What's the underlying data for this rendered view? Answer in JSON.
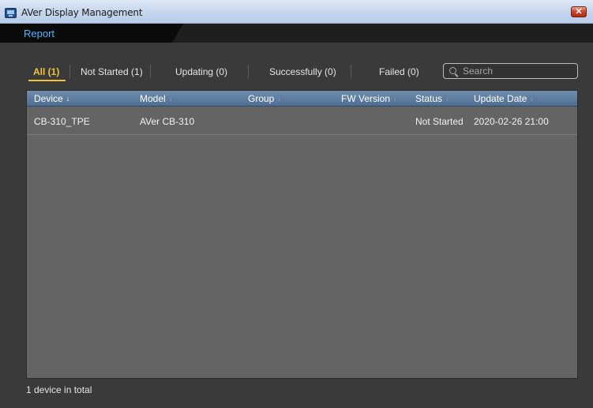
{
  "window": {
    "title": "AVer Display Management",
    "close_glyph": "✕"
  },
  "header": {
    "tab_label": "Report"
  },
  "filters": [
    {
      "label": "All (1)",
      "active": true
    },
    {
      "label": "Not Started (1)",
      "active": false
    },
    {
      "label": "Updating (0)",
      "active": false
    },
    {
      "label": "Successfully (0)",
      "active": false
    },
    {
      "label": "Failed (0)",
      "active": false
    }
  ],
  "search": {
    "placeholder": "Search",
    "value": ""
  },
  "table": {
    "columns": [
      {
        "label": "Device",
        "sort_active": true
      },
      {
        "label": "Model",
        "sort_active": false
      },
      {
        "label": "Group",
        "sort_active": false
      },
      {
        "label": "FW Version",
        "sort_active": false
      },
      {
        "label": "Status",
        "sort_active": false
      },
      {
        "label": "Update Date",
        "sort_active": false
      }
    ],
    "sort_glyph": "↓",
    "rows": [
      {
        "device": "CB-310_TPE",
        "model": "AVer CB-310",
        "group": "",
        "fw_version": "",
        "status": "Not Started",
        "update_date": "2020-02-26 21:00"
      }
    ]
  },
  "footer": {
    "count_text": "1 device in total"
  },
  "colors": {
    "accent_active_tab": "#f3c23a",
    "header_link": "#4fb6ff",
    "table_header": "#5a7a9e"
  }
}
